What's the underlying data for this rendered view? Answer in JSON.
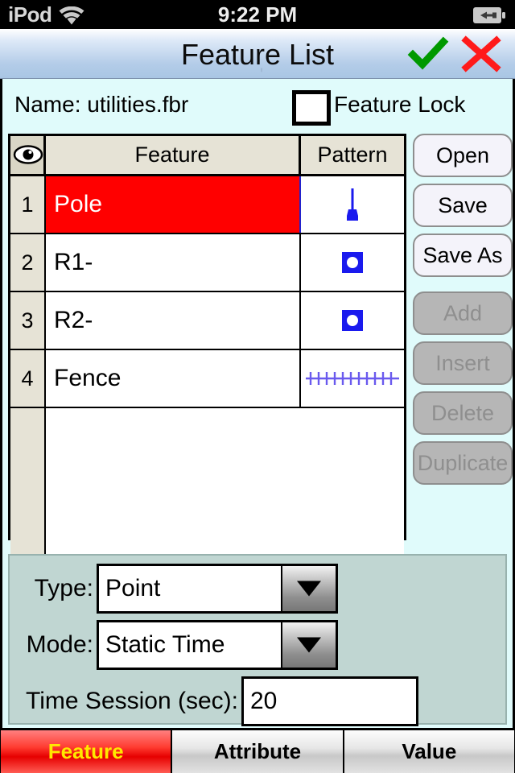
{
  "status_bar": {
    "carrier": "iPod",
    "wifi_icon": "wifi-icon",
    "time": "9:22 PM",
    "battery_icon": "battery-charging-icon"
  },
  "title_bar": {
    "title": "Feature List",
    "artifact": "'",
    "accept_icon": "checkmark-icon",
    "cancel_icon": "close-x-icon",
    "accept_color": "#009900",
    "cancel_color": "#ff1a1a"
  },
  "name_row": {
    "label": "Name:  utilities.fbr",
    "feature_lock_label": "Feature Lock",
    "feature_lock_checked": false
  },
  "table": {
    "visibility_icon": "eye-icon",
    "columns": [
      "",
      "Feature",
      "Pattern"
    ],
    "rows": [
      {
        "num": "1",
        "name": "Pole",
        "pattern": "pole-symbol",
        "selected": true
      },
      {
        "num": "2",
        "name": "R1-",
        "pattern": "square-symbol",
        "selected": false
      },
      {
        "num": "3",
        "name": "R2-",
        "pattern": "square-symbol",
        "selected": false
      },
      {
        "num": "4",
        "name": "Fence",
        "pattern": "fence-line-symbol",
        "selected": false
      }
    ],
    "selected_row_color": "#ff0000",
    "pattern_color": "#1a1aee"
  },
  "side_buttons": [
    {
      "label": "Open",
      "enabled": true
    },
    {
      "label": "Save",
      "enabled": true
    },
    {
      "label": "Save As",
      "enabled": true
    },
    {
      "label": "Add",
      "enabled": false
    },
    {
      "label": "Insert",
      "enabled": false
    },
    {
      "label": "Delete",
      "enabled": false
    },
    {
      "label": "Duplicate",
      "enabled": false
    }
  ],
  "form": {
    "type_label": "Type:",
    "type_value": "Point",
    "mode_label": "Mode:",
    "mode_value": "Static Time",
    "time_label": "Time Session (sec):",
    "time_value": "20",
    "dropdown_icon": "chevron-down-icon"
  },
  "tabs": [
    {
      "label": "Feature",
      "active": true
    },
    {
      "label": "Attribute",
      "active": false
    },
    {
      "label": "Value",
      "active": false
    }
  ]
}
